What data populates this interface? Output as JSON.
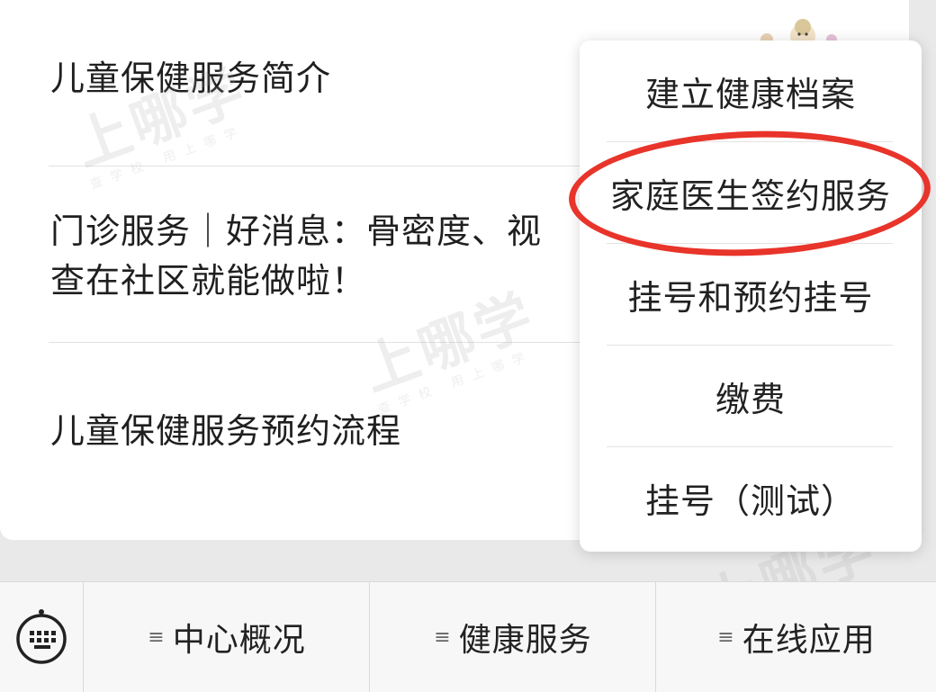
{
  "articles": [
    {
      "title": "儿童保健服务简介"
    },
    {
      "title_line1": "门诊服务｜好消息：骨密度、视",
      "title_line2": "查在社区就能做啦！"
    },
    {
      "title": "儿童保健服务预约流程"
    }
  ],
  "watermark": {
    "main": "上哪学",
    "sub": "查学校  用上哪学"
  },
  "popup_menu": {
    "items": [
      {
        "label": "建立健康档案"
      },
      {
        "label": "家庭医生签约服务"
      },
      {
        "label": "挂号和预约挂号"
      },
      {
        "label": "缴费"
      },
      {
        "label": "挂号（测试）"
      }
    ],
    "highlighted_item": "家庭医生签约服务",
    "highlight_color": "#e8342a"
  },
  "bottom_bar": {
    "keyboard_icon": "keyboard-icon",
    "menu_icon": "≡",
    "tabs": [
      {
        "label": "中心概况"
      },
      {
        "label": "健康服务"
      },
      {
        "label": "在线应用"
      }
    ]
  }
}
